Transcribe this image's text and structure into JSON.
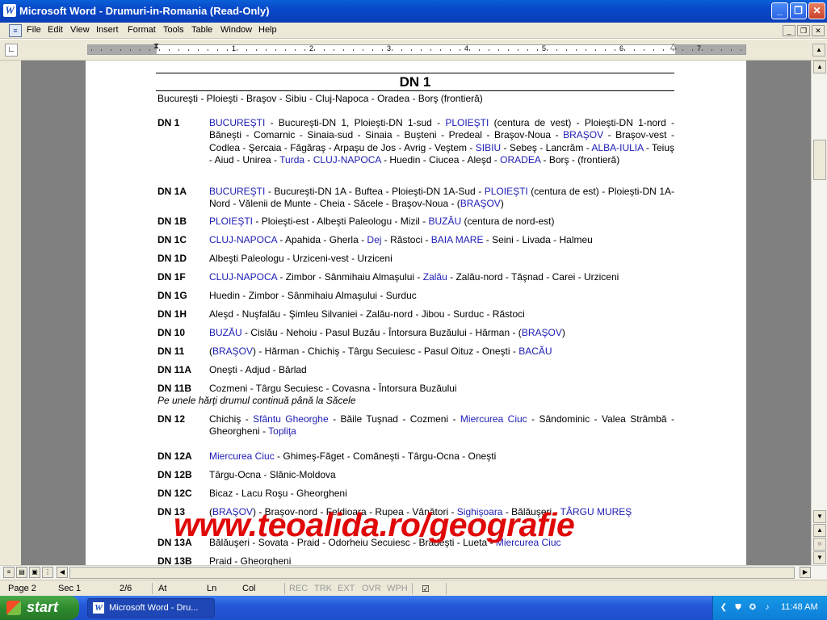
{
  "window": {
    "title": "Microsoft Word - Drumuri-in-Romania (Read-Only)",
    "app_icon": "W",
    "minimize_label": "_",
    "restore_label": "❐",
    "close_label": "✕"
  },
  "menu": {
    "items": [
      "File",
      "Edit",
      "View",
      "Insert",
      "Format",
      "Tools",
      "Table",
      "Window",
      "Help"
    ]
  },
  "ruler": {
    "numbers": [
      "1",
      "2",
      "3",
      "4",
      "5",
      "6",
      "7"
    ]
  },
  "document": {
    "heading": "DN 1",
    "subtitle": "Bucureşti - Ploieşti - Braşov - Sibiu - Cluj-Napoca - Oradea - Borş (frontieră)",
    "roads": [
      {
        "code": "DN 1",
        "segments": [
          {
            "t": "BUCUREŞTI",
            "c": true
          },
          {
            "t": " - Bucureşti-DN 1, Ploieşti-DN 1-sud - "
          },
          {
            "t": "PLOIEŞTI",
            "c": true
          },
          {
            "t": " (centura de vest) - Ploieşti-DN 1-nord - Băneşti - Comarnic - Sinaia-sud - Sinaia - Buşteni - Predeal - Braşov-Noua - "
          },
          {
            "t": "BRAŞOV",
            "c": true
          },
          {
            "t": " - Braşov-vest - Codlea - Şercaia - Făgăraş - Arpaşu de Jos - Avrig - Veştem - "
          },
          {
            "t": "SIBIU",
            "c": true
          },
          {
            "t": " - Sebeş - Lancrăm - "
          },
          {
            "t": "ALBA-IULIA",
            "c": true
          },
          {
            "t": " - Teiuş - Aiud - Unirea - "
          },
          {
            "t": "Turda",
            "c": true
          },
          {
            "t": " - "
          },
          {
            "t": "CLUJ-NAPOCA",
            "c": true
          },
          {
            "t": " - Huedin - Ciucea - Aleşd - "
          },
          {
            "t": "ORADEA",
            "c": true
          },
          {
            "t": " - Borş - (frontieră)"
          }
        ]
      },
      {
        "code": "DN 1A",
        "segments": [
          {
            "t": "BUCUREŞTI",
            "c": true
          },
          {
            "t": " - Bucureşti-DN 1A - Buftea - Ploieşti-DN 1A-Sud - "
          },
          {
            "t": "PLOIEŞTI",
            "c": true
          },
          {
            "t": " (centura de est) - Ploieşti-DN 1A-Nord - Vălenii de Munte - Cheia - Săcele - Braşov-Noua - ("
          },
          {
            "t": "BRAŞOV",
            "c": true
          },
          {
            "t": ")"
          }
        ]
      },
      {
        "code": "DN 1B",
        "segments": [
          {
            "t": "PLOIEŞTI",
            "c": true
          },
          {
            "t": " - Ploieşti-est - Albeşti Paleologu - Mizil - "
          },
          {
            "t": "BUZĂU",
            "c": true
          },
          {
            "t": " (centura de nord-est)"
          }
        ]
      },
      {
        "code": "DN 1C",
        "segments": [
          {
            "t": "CLUJ-NAPOCA",
            "c": true
          },
          {
            "t": " - Apahida - Gherla - "
          },
          {
            "t": "Dej",
            "c": true
          },
          {
            "t": " - Răstoci - "
          },
          {
            "t": "BAIA MARE",
            "c": true
          },
          {
            "t": " - Seini - Livada - Halmeu"
          }
        ]
      },
      {
        "code": "DN 1D",
        "segments": [
          {
            "t": "Albeşti Paleologu - Urziceni-vest - Urziceni"
          }
        ]
      },
      {
        "code": "DN 1F",
        "segments": [
          {
            "t": "CLUJ-NAPOCA",
            "c": true
          },
          {
            "t": " - Zimbor - Sânmihaiu Almaşului - "
          },
          {
            "t": "Zalău",
            "c": true
          },
          {
            "t": " - Zalău-nord - Tăşnad - Carei - Urziceni"
          }
        ]
      },
      {
        "code": "DN 1G",
        "segments": [
          {
            "t": "Huedin - Zimbor - Sânmihaiu Almaşului - Surduc"
          }
        ]
      },
      {
        "code": "DN 1H",
        "segments": [
          {
            "t": "Aleşd - Nuşfalău - Şimleu Silvaniei - Zalău-nord - Jibou - Surduc - Răstoci"
          }
        ]
      },
      {
        "code": "DN 10",
        "segments": [
          {
            "t": "BUZĂU",
            "c": true
          },
          {
            "t": " - Cislău - Nehoiu - Pasul Buzău - Întorsura Buzăului - Hărman - ("
          },
          {
            "t": "BRAŞOV",
            "c": true
          },
          {
            "t": ")"
          }
        ]
      },
      {
        "code": "DN 11",
        "segments": [
          {
            "t": "("
          },
          {
            "t": "BRAŞOV",
            "c": true
          },
          {
            "t": ") - Hărman - Chichiş - Târgu Secuiesc - Pasul Oituz - Oneşti - "
          },
          {
            "t": "BACĂU",
            "c": true
          }
        ]
      },
      {
        "code": "DN 11A",
        "segments": [
          {
            "t": "Oneşti - Adjud - Bârlad"
          }
        ]
      },
      {
        "code": "DN 11B",
        "segments": [
          {
            "t": "Cozmeni - Târgu Secuiesc - Covasna - Întorsura Buzăului"
          }
        ],
        "note": "Pe unele hărţi drumul continuă până la Săcele"
      },
      {
        "code": "DN 12",
        "segments": [
          {
            "t": "Chichiş - "
          },
          {
            "t": "Sfântu Gheorghe",
            "c": true
          },
          {
            "t": " - Băile Tuşnad - Cozmeni - "
          },
          {
            "t": "Miercurea Ciuc",
            "c": true
          },
          {
            "t": " - Sândominic - Valea Strâmbă - Gheorgheni - "
          },
          {
            "t": "Topliţa",
            "c": true
          }
        ]
      },
      {
        "code": "DN 12A",
        "segments": [
          {
            "t": "Miercurea Ciuc",
            "c": true
          },
          {
            "t": " - Ghimeş-Făget - Comăneşti - Târgu-Ocna - Oneşti"
          }
        ]
      },
      {
        "code": "DN 12B",
        "segments": [
          {
            "t": "Târgu-Ocna - Slănic-Moldova"
          }
        ]
      },
      {
        "code": "DN 12C",
        "segments": [
          {
            "t": "Bicaz - Lacu Roşu - Gheorgheni"
          }
        ]
      },
      {
        "code": "DN 13",
        "segments": [
          {
            "t": "("
          },
          {
            "t": "BRAŞOV",
            "c": true
          },
          {
            "t": ") - Braşov-nord - Feldioara - Rupea - Vânători - "
          },
          {
            "t": "Sighişoara",
            "c": true
          },
          {
            "t": " - Bălăuşeri - "
          },
          {
            "t": "TÂRGU MUREŞ",
            "c": true
          }
        ]
      },
      {
        "code": "DN 13A",
        "segments": [
          {
            "t": "Bălăuşeri - Sovata - Praid - Odorheiu Secuiesc - Brădeşti - Lueta - "
          },
          {
            "t": "Miercurea Ciuc",
            "c": true
          }
        ]
      },
      {
        "code": "DN 13B",
        "segments": [
          {
            "t": "Praid - Gheorgheni"
          }
        ]
      }
    ],
    "watermark": "www.teoalida.ro/geografie"
  },
  "statusbar": {
    "page": "Page 2",
    "sec": "Sec 1",
    "pages": "2/6",
    "at": "At",
    "ln": "Ln",
    "col": "Col",
    "rec": "REC",
    "trk": "TRK",
    "ext": "EXT",
    "ovr": "OVR",
    "wph": "WPH"
  },
  "taskbar": {
    "start_label": "start",
    "task_label": "Microsoft Word - Dru...",
    "clock": "11:48 AM"
  },
  "colors": {
    "city_link": "#1c1cb4",
    "watermark": "#e00808"
  }
}
